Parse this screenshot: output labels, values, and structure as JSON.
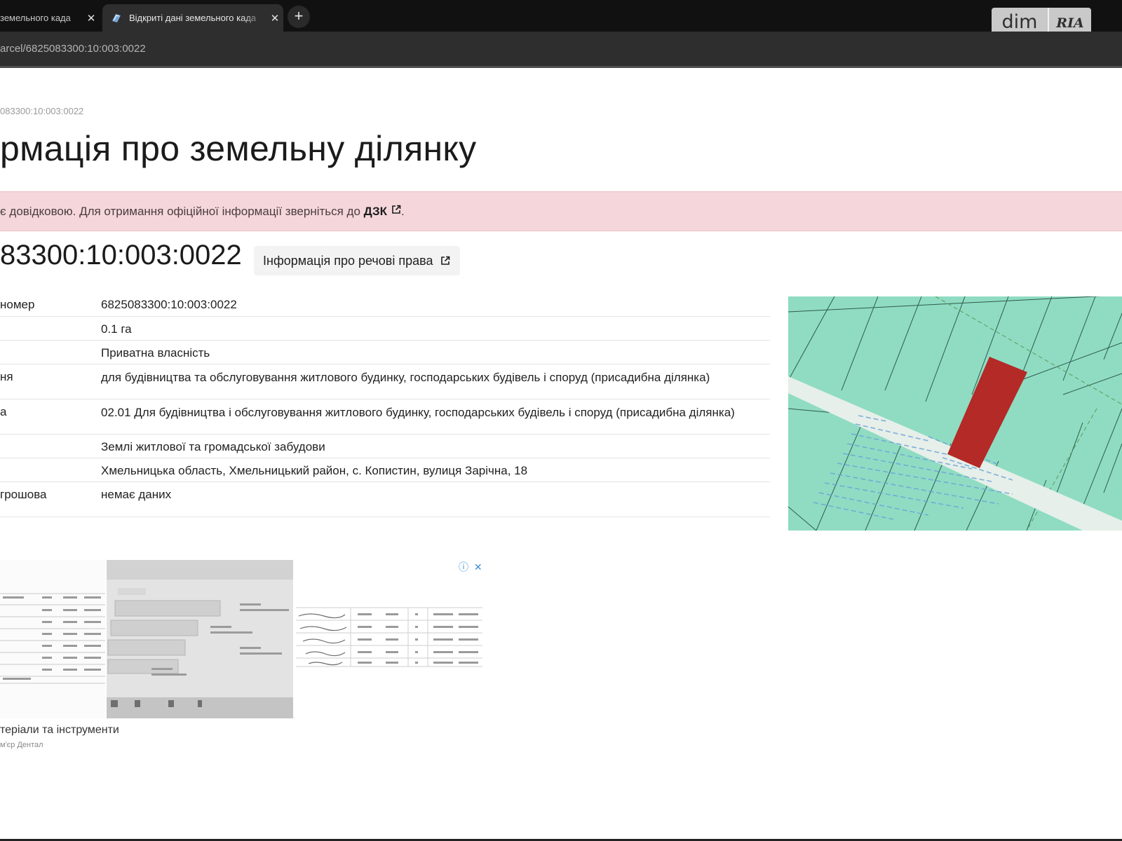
{
  "browser": {
    "tabs": [
      {
        "title": "земельного када",
        "active": false,
        "close": "✕"
      },
      {
        "title": "Відкриті дані земельного када",
        "active": true,
        "close": "✕"
      }
    ],
    "new_tab": "+",
    "url": "arcel/6825083300:10:003:0022",
    "overlay_logo": {
      "dim": "dim",
      "ria": "RIA"
    }
  },
  "page": {
    "breadcrumb": "083300:10:003:0022",
    "title": "рмація про земельну ділянку",
    "alert": {
      "text": "є довідковою. Для отримання офіційної інформації зверніться до ",
      "link": "ДЗК",
      "suffix": "."
    },
    "parcel_number": "83300:10:003:0022",
    "rights_button": "Інформація про речові права",
    "rows": [
      {
        "label": "номер",
        "value": "6825083300:10:003:0022"
      },
      {
        "label": "",
        "value": "0.1 га"
      },
      {
        "label": "",
        "value": "Приватна власність"
      },
      {
        "label": "ня",
        "value": "для будівництва та обслуговування житлового будинку, господарських будівель і споруд (присадибна ділянка)"
      },
      {
        "label": "а",
        "value": "02.01 Для будівництва і обслуговування житлового будинку, господарських будівель і споруд (присадибна ділянка)"
      },
      {
        "label": "",
        "value": "Землі житлової та громадської забудови"
      },
      {
        "label": "",
        "value": "Хмельницька область, Хмельницький район, с. Копистин, вулиця Зарічна, 18"
      },
      {
        "label": "грошова",
        "value": "немає даних"
      }
    ],
    "ad": {
      "caption": "теріали та інструменти",
      "source": "м'єр Дентал",
      "info_icon": "ⓘ",
      "close_icon": "✕"
    }
  },
  "colors": {
    "map_parcel": "#e2f3ec",
    "map_land": "#8fdcc3",
    "selected_parcel": "#b32a26",
    "alert_bg": "#f5d7db"
  },
  "icons": [
    "favicon-icon",
    "close-icon",
    "plus-icon",
    "external-link-icon",
    "info-icon"
  ]
}
